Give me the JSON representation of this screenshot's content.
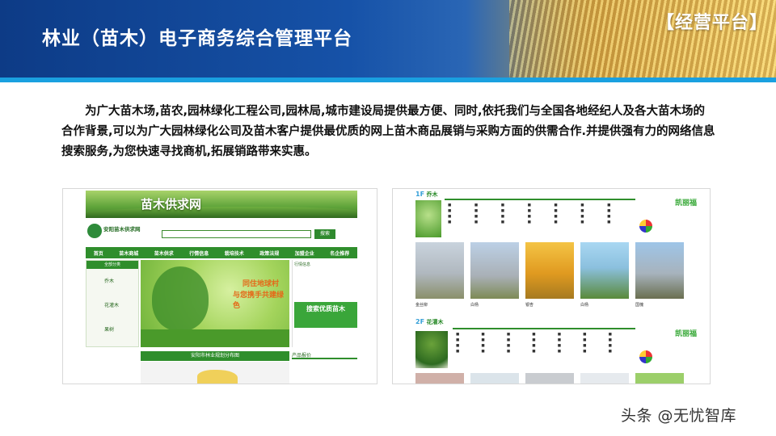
{
  "header": {
    "title": "林业（苗木）电子商务综合管理平台",
    "tag": "【经营平台】"
  },
  "intro": "为广大苗木场,苗农,园林绿化工程公司,园林局,城市建设局提供最方便、同时,依托我们与全国各地经纪人及各大苗木场的合作背景,可以为广大园林绿化公司及苗木客户提供最优质的网上苗木商品展销与采购方面的供需合作.并提供强有力的网络信息搜索服务,为您快速寻找商机,拓展销路带来实惠。",
  "left_site": {
    "banner_title": "苗木供求网",
    "logo_text": "安阳苗木供求网",
    "search_button": "搜索",
    "nav": [
      "首页",
      "苗木商城",
      "苗木供求",
      "行情信息",
      "栽培技术",
      "政策法规",
      "加盟企业",
      "名企推荐"
    ],
    "side_head": "全部分类",
    "side_items": [
      "乔木",
      "花灌木",
      "果树"
    ],
    "hero_line1": "同住地球村",
    "hero_line2": "与您携手共建绿色",
    "right_head": "行情信息",
    "promo": "搜索优质苗木",
    "map_head": "安阳市林业规划分布图",
    "products_head": "产品报价"
  },
  "right_site": {
    "floor1_num": "1F",
    "floor1_name": "乔木",
    "floor2_num": "2F",
    "floor2_name": "花灌木",
    "tree_captions": [
      "金丝柳",
      "白杨",
      "银杏",
      "白杨",
      "国槐"
    ],
    "brand_name": "凯丽福"
  },
  "watermark": "头条 @无忧智库"
}
